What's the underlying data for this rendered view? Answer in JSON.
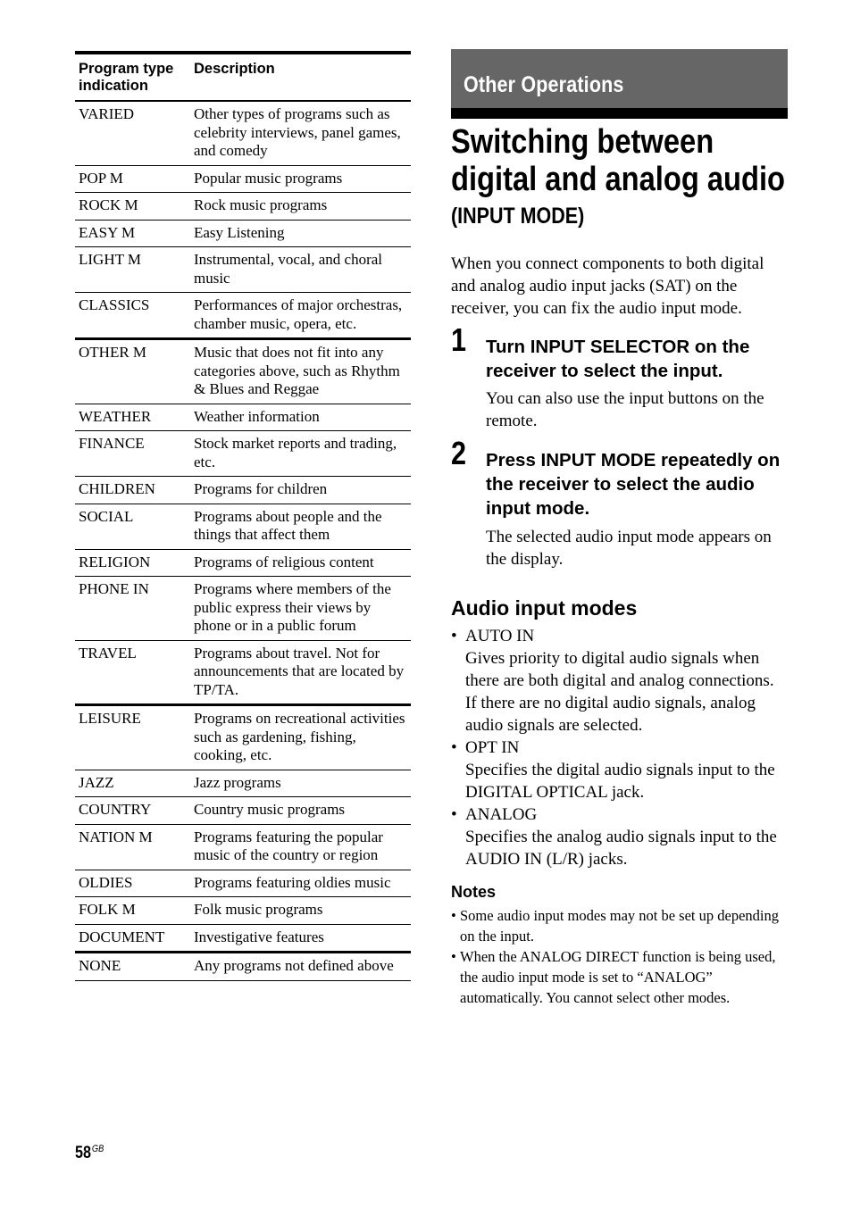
{
  "table": {
    "headers": [
      "Program type indication",
      "Description"
    ],
    "rows": [
      {
        "type": "VARIED",
        "description": "Other types of programs such as celebrity interviews, panel games, and comedy"
      },
      {
        "type": "POP M",
        "description": "Popular music programs"
      },
      {
        "type": "ROCK M",
        "description": "Rock music programs"
      },
      {
        "type": "EASY M",
        "description": "Easy Listening"
      },
      {
        "type": "LIGHT M",
        "description": "Instrumental, vocal, and choral music"
      },
      {
        "type": "CLASSICS",
        "description": "Performances of major orchestras, chamber music, opera, etc."
      },
      {
        "type": "OTHER M",
        "description": "Music that does not fit into any categories above, such as Rhythm & Blues and Reggae"
      },
      {
        "type": "WEATHER",
        "description": "Weather information"
      },
      {
        "type": "FINANCE",
        "description": "Stock market reports and trading, etc."
      },
      {
        "type": "CHILDREN",
        "description": "Programs for children"
      },
      {
        "type": "SOCIAL",
        "description": "Programs about people and the things that affect them"
      },
      {
        "type": "RELIGION",
        "description": "Programs of religious content"
      },
      {
        "type": "PHONE IN",
        "description": "Programs where members of the public express their views by phone or in a public forum"
      },
      {
        "type": "TRAVEL",
        "description": "Programs about travel. Not for announcements that are located by TP/TA."
      },
      {
        "type": "LEISURE",
        "description": "Programs on recreational activities such as gardening, fishing, cooking, etc."
      },
      {
        "type": "JAZZ",
        "description": "Jazz programs"
      },
      {
        "type": "COUNTRY",
        "description": "Country music programs"
      },
      {
        "type": "NATION M",
        "description": "Programs featuring the popular music of the country or region"
      },
      {
        "type": "OLDIES",
        "description": "Programs featuring oldies music"
      },
      {
        "type": "FOLK M",
        "description": "Folk music programs"
      },
      {
        "type": "DOCUMENT",
        "description": "Investigative features"
      },
      {
        "type": "NONE",
        "description": "Any programs not defined above"
      }
    ]
  },
  "section": {
    "title": "Other Operations"
  },
  "page": {
    "title": "Switching between digital and analog audio",
    "subtitle": "(INPUT MODE)",
    "intro": "When you connect components to both digital and analog audio input jacks (SAT) on the receiver, you can fix the audio input mode.",
    "number": "58",
    "number_suffix": "GB"
  },
  "steps": [
    {
      "number": "1",
      "heading": "Turn INPUT SELECTOR on the receiver to select the input.",
      "body": "You can also use the input buttons on the remote."
    },
    {
      "number": "2",
      "heading": "Press INPUT MODE repeatedly on the receiver to select the audio input mode.",
      "body": "The selected audio input mode appears on the display."
    }
  ],
  "modes": {
    "heading": "Audio input modes",
    "items": [
      {
        "name": "AUTO IN",
        "description": "Gives priority to digital audio signals when there are both digital and analog connections. If there are no digital audio signals, analog audio signals are selected."
      },
      {
        "name": "OPT IN",
        "description": "Specifies the digital audio signals input to the DIGITAL OPTICAL jack."
      },
      {
        "name": "ANALOG",
        "description": "Specifies the analog audio signals input to the AUDIO IN (L/R) jacks."
      }
    ]
  },
  "notes": {
    "heading": "Notes",
    "items": [
      "Some audio input modes may not be set up depending on the input.",
      "When the ANALOG DIRECT function is being used, the audio input mode is set to “ANALOG” automatically. You cannot select other modes."
    ]
  },
  "bullet": "•"
}
